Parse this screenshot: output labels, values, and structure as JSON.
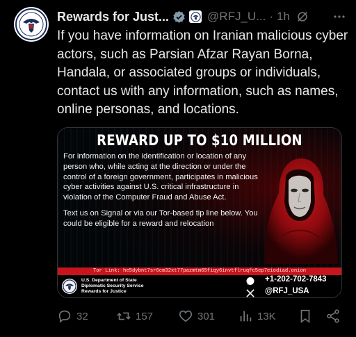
{
  "tweet": {
    "display_name": "Rewards for Just...",
    "handle": "@RFJ_U...",
    "separator": "·",
    "time": "1h",
    "text": "If you have information on Iranian malicious cyber actors, such as Parsian Afzar Rayan Borna, Handala, or associated groups or individuals, contact us with any information, such as names, online personas, and locations."
  },
  "media": {
    "title": "REWARD UP TO $10 MILLION",
    "paragraph_1": "For information on the identification or location of any person who, while acting at the direction or under the control of a foreign government, participates in malicious cyber activities against U.S. critical infrastructure in violation of the Computer Fraud and Abuse Act.",
    "paragraph_2": "Text us on Signal or via our Tor-based tip line below. You could be eligible for a reward and relocation",
    "tor_link": "Tor Link: he5dybnt7sr6cm32xt77pazmtm65fiqy6invtflruqfc5ep7eiodiad.onion",
    "dept_lines": [
      "U.S. Department of State",
      "Diplomatic Security Service",
      "Rewards for Justice"
    ],
    "phone": "+1-202-702-7843",
    "x_handle": "@RFJ_USA"
  },
  "actions": {
    "replies": "32",
    "reposts": "157",
    "likes": "301",
    "views": "13K"
  },
  "colors": {
    "background": "#000000",
    "text": "#e7e9ea",
    "muted": "#71767b",
    "verified": "#829aab",
    "tor_bar": "#c8141c"
  },
  "icons": [
    "avatar-seal",
    "verified-badge",
    "affiliate-badge",
    "grok-icon",
    "more-icon",
    "reply-icon",
    "repost-icon",
    "like-icon",
    "views-icon",
    "bookmark-icon",
    "share-icon",
    "signal-icon",
    "x-icon"
  ]
}
